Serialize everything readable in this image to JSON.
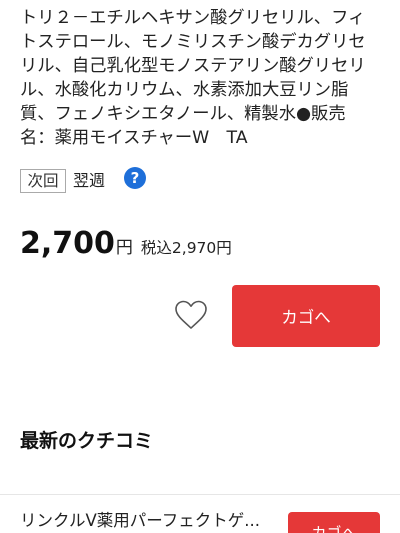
{
  "ingredients": {
    "lines": [
      "トリ２－エチルヘキサン酸グリセリル、フィ",
      "トステロール、モノミリスチン酸デカグリセ",
      "リル、自己乳化型モノステアリン酸グリセリ",
      "ル、水酸化カリウム、水素添加大豆リン脂",
      "質、フェノキシエタノール、精製水●販売",
      "名：薬用モイスチャーW　TA"
    ]
  },
  "delivery": {
    "label": "次回",
    "value": "翌週"
  },
  "help": {
    "icon": "question-circle-icon",
    "glyph": "?"
  },
  "price": {
    "amount": "2,700",
    "unit": "円",
    "tax_included": "税込2,970円"
  },
  "favorite": {
    "icon": "heart-outline-icon"
  },
  "cart_button": {
    "label": "カゴへ"
  },
  "reviews": {
    "heading": "最新のクチコミ"
  },
  "related_item": {
    "title": "リンクルV薬用パーフェクトゲ...",
    "cart_label": "カゴへ"
  },
  "colors": {
    "accent": "#e53838",
    "help": "#1e6fd9",
    "heart_stroke": "#555555"
  }
}
